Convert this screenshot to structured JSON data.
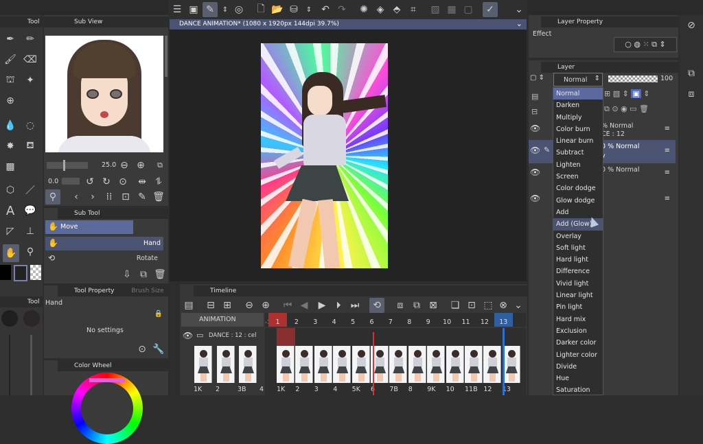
{
  "tool_panel": {
    "title": "Tool",
    "tool_label_2": "Tool"
  },
  "sub_view": {
    "title": "Sub View"
  },
  "canvas": {
    "tab_title": "DANCE ANIMATION* (1080 x 1920px 144dpi 39.7%)"
  },
  "nav": {
    "zoom_value": "25.0",
    "rotate_value": "0.0"
  },
  "sub_tool": {
    "title": "Sub Tool",
    "items": [
      {
        "label": "Move"
      },
      {
        "label": "Hand"
      },
      {
        "label": "Rotate"
      }
    ]
  },
  "tool_property": {
    "title": "Tool Property",
    "tab2": "Brush Size",
    "name": "Hand",
    "empty": "No settings"
  },
  "color_wheel": {
    "title": "Color Wheel"
  },
  "timeline": {
    "title": "Timeline",
    "track_name": "ANIMATION",
    "layer_name": "DANCE : 12 : cel",
    "frame_numbers": [
      "1",
      "2",
      "3",
      "4",
      "5",
      "6",
      "7",
      "8",
      "9",
      "10",
      "11",
      "12",
      "13"
    ],
    "left_ruler": "-1",
    "left_cel_labels": [
      "1K",
      "2",
      "3B",
      "4"
    ],
    "cel_labels": [
      "1K",
      "2",
      "3",
      "4",
      "5K",
      "6",
      "7B",
      "8",
      "9K",
      "10",
      "11B",
      "12",
      "13"
    ],
    "frame_count": 13,
    "current_frame": 1,
    "playhead_frame": 6
  },
  "layer_property": {
    "title": "Layer Property",
    "effect_label": "Effect"
  },
  "layer": {
    "title": "Layer",
    "blend_mode": "Normal",
    "opacity": "100",
    "rows": [
      {
        "text": "% Normal",
        "sub": "CE : 12"
      },
      {
        "text": "0 % Normal",
        "sub": "y"
      },
      {
        "text": "0 % Normal",
        "sub": ""
      }
    ]
  },
  "blend_dropdown": {
    "items": [
      "Normal",
      "Darken",
      "Multiply",
      "Color burn",
      "Linear burn",
      "Subtract",
      "Lighten",
      "Screen",
      "Color dodge",
      "Glow dodge",
      "Add",
      "Add (Glow)",
      "Overlay",
      "Soft light",
      "Hard light",
      "Difference",
      "Vivid light",
      "Linear light",
      "Pin light",
      "Hard mix",
      "Exclusion",
      "Darker color",
      "Lighter color",
      "Divide",
      "Hue",
      "Saturation"
    ],
    "selected": "Normal",
    "hovered": "Add (Glow)"
  },
  "colors": {
    "accent": "#5a6aa0",
    "selection": "#4b5372",
    "dropdown_bg": "#2e2e2e"
  }
}
